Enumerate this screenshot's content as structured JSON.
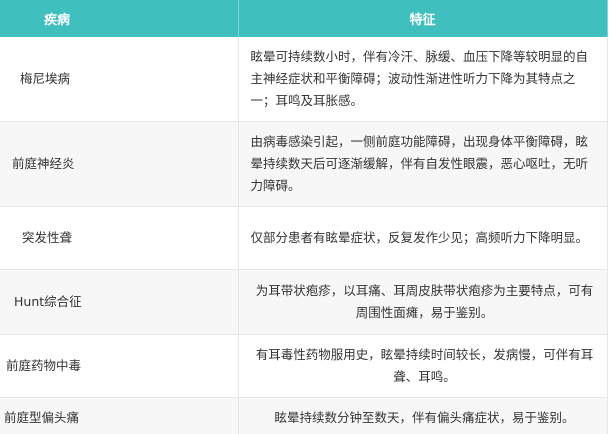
{
  "header": {
    "col_disease": "疾病",
    "col_feature": "特征"
  },
  "rows": [
    {
      "name": "梅尼埃病",
      "feature": "眩晕可持续数小时，伴有冷汗、脉缓、血压下降等较明显的自主神经症状和平衡障碍；波动性渐进性听力下降为其特点之一；耳鸣及耳胀感。"
    },
    {
      "name": "前庭神经炎",
      "feature": "由病毒感染引起，一侧前庭功能障碍，出现身体平衡障碍，眩晕持续数天后可逐渐缓解，伴有自发性眼震，恶心呕吐，无听力障碍。"
    },
    {
      "name": "突发性聋",
      "feature": "仅部分患者有眩晕症状，反复发作少见；高频听力下降明显。"
    },
    {
      "name": "Hunt综合征",
      "feature": "为耳带状疱疹，以耳痛、耳周皮肤带状疱疹为主要特点，可有周围性面瘫，易于鉴别。"
    },
    {
      "name": "前庭药物中毒",
      "feature": "有耳毒性药物服用史，眩晕持续时间较长，发病慢，可伴有耳聋、耳鸣。"
    },
    {
      "name": "前庭型偏头痛",
      "feature": "眩晕持续数分钟至数天，伴有偏头痛症状，易于鉴别。"
    }
  ],
  "colors": {
    "header_bg": "#40bfbf",
    "header_text": "#ffffff",
    "row_alt_bg": "#f7f7f7",
    "border": "#e6e6e6"
  }
}
